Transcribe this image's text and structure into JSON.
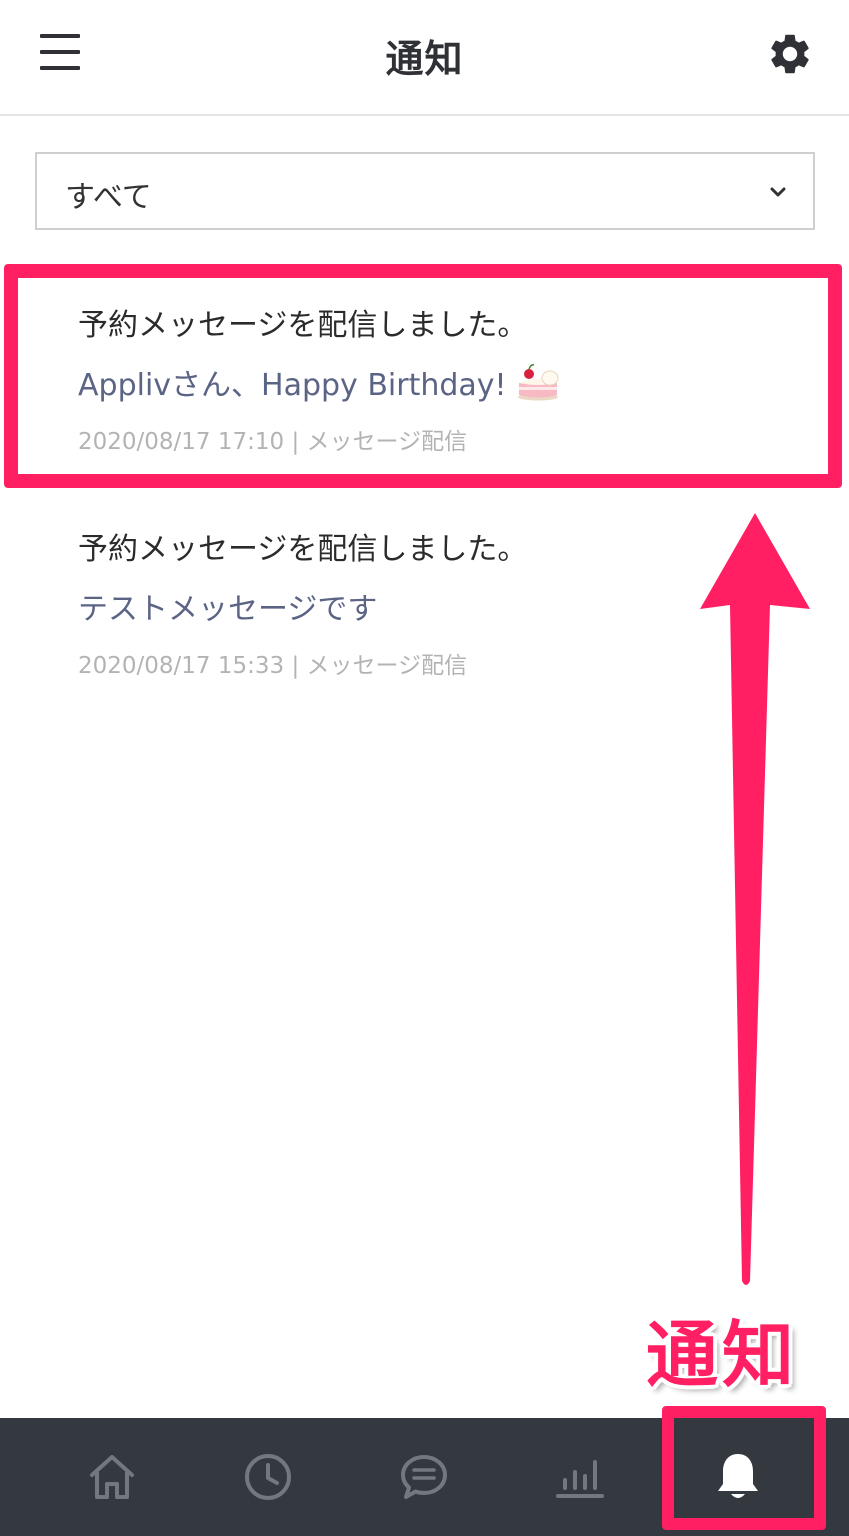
{
  "header": {
    "title": "通知",
    "menu_icon": "hamburger-menu-icon",
    "settings_icon": "gear-icon"
  },
  "filter": {
    "selected": "すべて",
    "icon": "chevron-down-icon"
  },
  "notifications": [
    {
      "title": "予約メッセージを配信しました。",
      "body": "Applivさん、Happy Birthday!",
      "body_icon": "cake-icon",
      "meta": "2020/08/17 17:10 | メッセージ配信",
      "highlighted": true
    },
    {
      "title": "予約メッセージを配信しました。",
      "body": "テストメッセージです",
      "meta": "2020/08/17 15:33 | メッセージ配信",
      "highlighted": false
    }
  ],
  "annotation": {
    "label": "通知",
    "color": "#ff1f62"
  },
  "bottom_nav": {
    "items": [
      {
        "name": "home",
        "icon": "home-icon"
      },
      {
        "name": "history",
        "icon": "clock-icon"
      },
      {
        "name": "chat",
        "icon": "chat-bubble-icon"
      },
      {
        "name": "stats",
        "icon": "bar-chart-icon"
      },
      {
        "name": "notifications",
        "icon": "bell-icon",
        "active": true
      }
    ],
    "background": "#343940"
  }
}
